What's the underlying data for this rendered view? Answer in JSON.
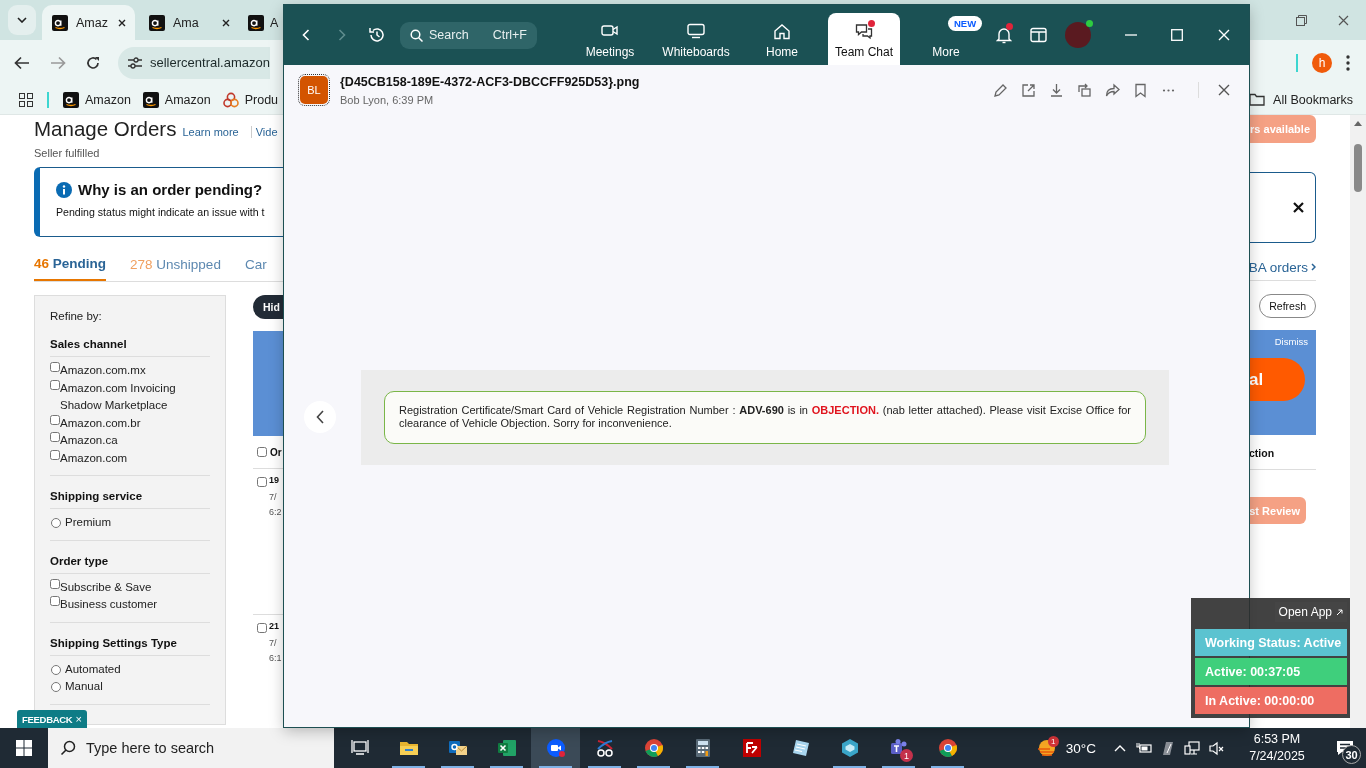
{
  "browser": {
    "tabs": [
      {
        "title": "Amaz",
        "selected": true
      },
      {
        "title": "Ama",
        "selected": false
      },
      {
        "title": "A",
        "selected": false
      }
    ],
    "url": "sellercentral.amazon",
    "profile": "h",
    "bookmarks": [
      "Amazon",
      "Amazon",
      "Produ"
    ],
    "all_bookmarks": "All Bookmarks"
  },
  "page": {
    "title": "Manage Orders",
    "links": [
      "Learn more",
      "Vide"
    ],
    "subtitle": "Seller fulfilled",
    "alert": {
      "title": "Why is an order pending?",
      "text": "Pending status might indicate an issue with t"
    },
    "order_tabs": [
      {
        "count": "46",
        "label": "Pending",
        "selected": true
      },
      {
        "count": "278",
        "label": "Unshipped",
        "selected": false
      },
      {
        "label": "Car",
        "selected": false
      }
    ],
    "refine": {
      "title": "Refine by:",
      "sections": [
        {
          "title": "Sales channel",
          "options": [
            {
              "kind": "checkbox",
              "label": "Amazon.com.mx",
              "checked": false
            },
            {
              "kind": "checkbox",
              "label": "Amazon.com Invoicing Shadow Marketplace",
              "checked": false
            },
            {
              "kind": "checkbox",
              "label": "Amazon.com.br",
              "checked": false
            },
            {
              "kind": "checkbox",
              "label": "Amazon.ca",
              "checked": false
            },
            {
              "kind": "checkbox",
              "label": "Amazon.com",
              "checked": false
            }
          ]
        },
        {
          "title": "Shipping service",
          "options": [
            {
              "kind": "radio",
              "label": "Premium",
              "checked": false
            }
          ]
        },
        {
          "title": "Order type",
          "options": [
            {
              "kind": "checkbox",
              "label": "Subscribe & Save",
              "checked": false
            },
            {
              "kind": "checkbox",
              "label": "Business customer",
              "checked": false
            }
          ]
        },
        {
          "title": "Shipping Settings Type",
          "options": [
            {
              "kind": "radio",
              "label": "Automated",
              "checked": false
            },
            {
              "kind": "radio",
              "label": "Manual",
              "checked": false
            }
          ]
        }
      ]
    },
    "hide_button": "Hid",
    "orders": {
      "header": {
        "label": "Or",
        "checked": false
      },
      "rows": [
        {
          "id": "19",
          "date": "7/",
          "time": "6:2",
          "checked": false
        },
        {
          "id": "21",
          "date": "7/",
          "time": "6:1",
          "checked": false
        }
      ]
    },
    "right": {
      "banner": "rs available",
      "fba_link": "BA orders",
      "refresh": "Refresh",
      "dismiss": "Dismiss",
      "promo_button": "al",
      "column_header": "ction",
      "review_button": "st Review"
    },
    "feedback": {
      "label": "FEEDBACK",
      "close": "×"
    }
  },
  "zoom": {
    "search": {
      "placeholder": "Search",
      "shortcut": "Ctrl+F"
    },
    "nav": [
      {
        "kind": "meetings",
        "label": "Meetings",
        "selected": false,
        "unread": false
      },
      {
        "kind": "whiteboards",
        "label": "Whiteboards",
        "selected": false,
        "unread": false
      },
      {
        "kind": "home",
        "label": "Home",
        "selected": false,
        "unread": false
      },
      {
        "kind": "chat",
        "label": "Team Chat",
        "selected": true,
        "unread": true
      },
      {
        "kind": "more",
        "label": "More",
        "selected": false,
        "unread": false,
        "badge": "NEW"
      }
    ],
    "notifications": {
      "unread": true
    },
    "online": true,
    "file": {
      "avatar": "BL",
      "name": "{D45CB158-189E-4372-ACF3-DBCCFF925D53}.png",
      "meta": "Bob Lyon, 6:39 PM"
    },
    "image_text": [
      {
        "kind": "plain",
        "text": "Registration Certificate/Smart Card of Vehicle Registration Number : "
      },
      {
        "kind": "bold",
        "text": "ADV-690"
      },
      {
        "kind": "plain",
        "text": " is in "
      },
      {
        "kind": "alert",
        "text": "OBJECTION."
      },
      {
        "kind": "plain",
        "text": " (nab letter attached). Please visit Excise Office for clearance of Vehicle Objection. Sorry for inconvenience."
      }
    ]
  },
  "tracker": {
    "open_app": "Open App",
    "statuses": [
      {
        "text": "Working Status: Active",
        "color": "#5bc3d0"
      },
      {
        "text": "Active: 00:37:05",
        "color": "#3fcf7c"
      },
      {
        "text": "In Active: 00:00:00",
        "color": "#ee6d62"
      }
    ]
  },
  "taskbar": {
    "search": {
      "placeholder": "Type here to search"
    },
    "apps": [
      {
        "kind": "taskview",
        "selected": false,
        "running": false
      },
      {
        "kind": "folder",
        "selected": false,
        "running": true
      },
      {
        "kind": "mail",
        "selected": false,
        "running": true
      },
      {
        "kind": "sheet",
        "selected": false,
        "running": true
      },
      {
        "kind": "video",
        "selected": true,
        "running": true
      },
      {
        "kind": "snip",
        "selected": false,
        "running": true
      },
      {
        "kind": "browser",
        "selected": false,
        "running": true
      },
      {
        "kind": "calculator",
        "selected": false,
        "running": true
      },
      {
        "kind": "ftp",
        "selected": false,
        "running": false
      },
      {
        "kind": "notepad",
        "selected": false,
        "running": false
      },
      {
        "kind": "hexagon",
        "selected": false,
        "running": true
      },
      {
        "kind": "teams",
        "selected": false,
        "running": true,
        "badge": "1"
      },
      {
        "kind": "browser",
        "selected": false,
        "running": true
      }
    ],
    "weather": {
      "badge": "1",
      "temperature": "30°C"
    },
    "tray": [
      {
        "kind": "chevron"
      },
      {
        "kind": "battery"
      },
      {
        "kind": "app"
      },
      {
        "kind": "network"
      },
      {
        "kind": "mute"
      }
    ],
    "time": "6:53 PM",
    "date": "7/24/2025",
    "notifications": "30"
  }
}
